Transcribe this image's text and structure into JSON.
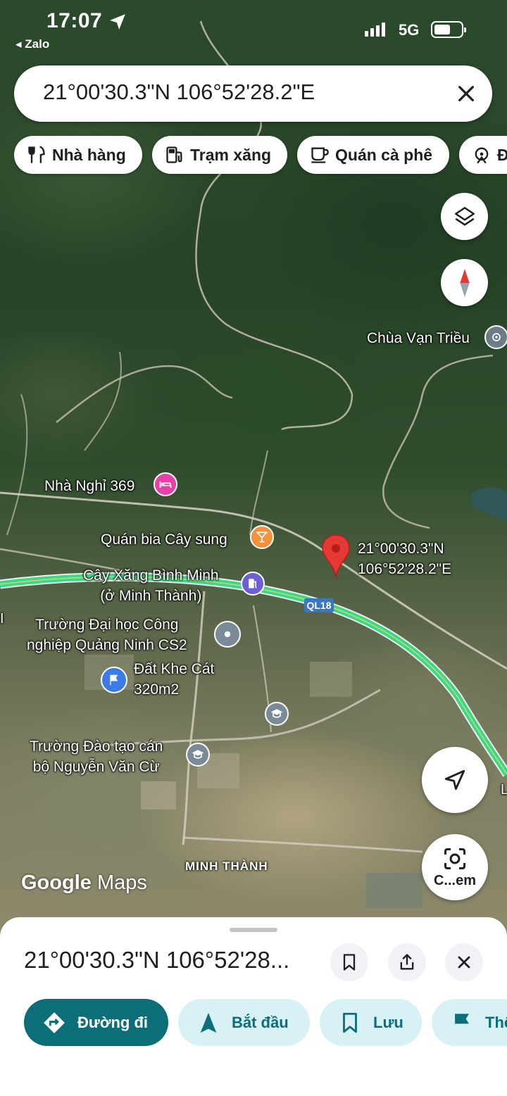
{
  "status_bar": {
    "time": "17:07",
    "back_app": "◂ Zalo",
    "network": "5G"
  },
  "search": {
    "query": "21°00'30.3\"N 106°52'28.2\"E"
  },
  "chips": [
    {
      "label": "Nhà hàng",
      "icon": "restaurant-icon"
    },
    {
      "label": "Trạm xăng",
      "icon": "gas-station-icon"
    },
    {
      "label": "Quán cà phê",
      "icon": "coffee-icon"
    },
    {
      "label": "Đ",
      "icon": "attraction-icon"
    }
  ],
  "map": {
    "places": [
      {
        "name": "Chùa Vạn Triều",
        "icon": "temple-icon"
      },
      {
        "name": "Nhà Nghỉ 369",
        "icon": "hotel-icon",
        "color": "#e93fa7"
      },
      {
        "name": "Quán bia Cây sung",
        "icon": "bar-icon",
        "color": "#f3923a"
      },
      {
        "name": "Cây Xăng Bình Minh",
        "subname": "(ở Minh Thành)",
        "icon": "gas-station-icon",
        "color": "#6a5fd4"
      },
      {
        "name": "Trường Đại học Công",
        "subname": "nghiệp Quảng Ninh CS2",
        "icon": "place-icon",
        "color": "#7a8b97"
      },
      {
        "name": "Đất Khe Cát",
        "subname": "320m2",
        "icon": "flag-icon",
        "color": "#3b7be6"
      },
      {
        "name": "Trường Đào tạo cán",
        "subname": "bộ Nguyễn Văn Cừ",
        "icon": "school-icon",
        "color": "#7a8b97"
      }
    ],
    "pin_label_line1": "21°00'30.3\"N",
    "pin_label_line2": "106°52'28.2\"E",
    "road_shield": "QL18",
    "area_name": "MINH THÀNH",
    "watermark_a": "Google",
    "watermark_b": "Maps",
    "edge_label_left": "I",
    "edge_label_right": "L",
    "route_color": "#39d98a"
  },
  "lens_button": {
    "label": "C...em"
  },
  "sheet": {
    "title": "21°00'30.3\"N 106°52'28...",
    "actions": [
      {
        "label": "Đường đi",
        "icon": "directions-icon",
        "primary": true
      },
      {
        "label": "Bắt đầu",
        "icon": "navigation-icon",
        "primary": false
      },
      {
        "label": "Lưu",
        "icon": "bookmark-icon",
        "primary": false
      },
      {
        "label": "Thê",
        "icon": "flag-icon",
        "primary": false
      }
    ]
  },
  "colors": {
    "accent": "#0b6e78",
    "accent_light": "#d7f1f5",
    "marker_red": "#e53935"
  }
}
